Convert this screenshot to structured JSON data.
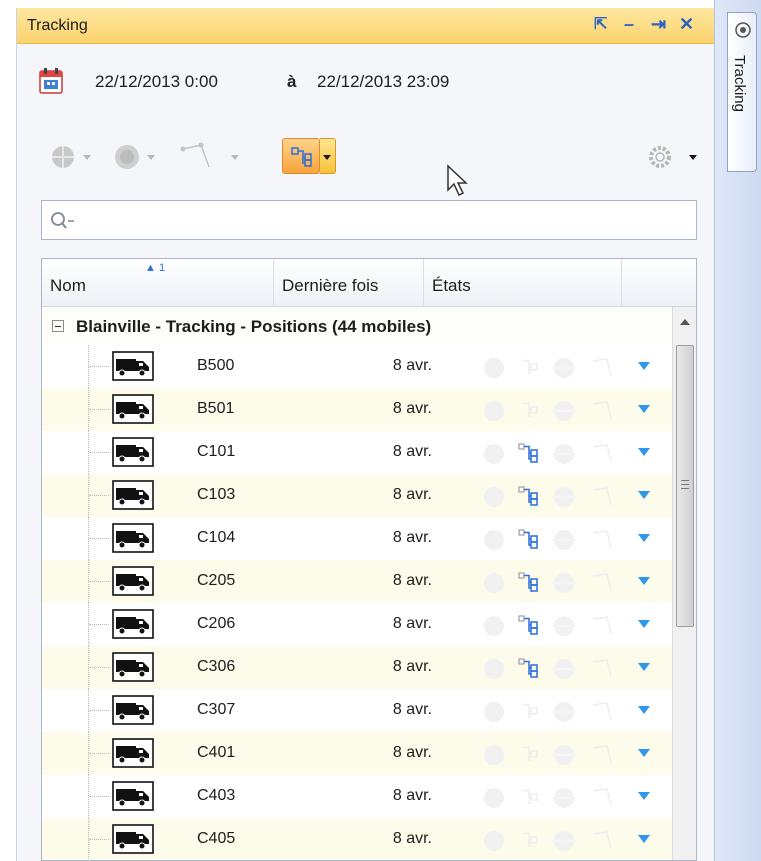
{
  "panel": {
    "title": "Tracking",
    "controls": [
      "⇱",
      "–",
      "⇥",
      "✕"
    ]
  },
  "daterange": {
    "from": "22/12/2013  0:00",
    "separator": "à",
    "to": "22/12/2013  23:09"
  },
  "toolbar": {
    "icons": [
      "map-point-icon",
      "circle-target-icon",
      "route-icon",
      "tree-view-icon",
      "settings-gear-icon"
    ]
  },
  "search": {
    "placeholder": ""
  },
  "grid": {
    "columns": [
      "Nom",
      "Dernière fois",
      "États"
    ],
    "sort_indicator": "1",
    "group_label": "Blainville - Tracking - Positions (44 mobiles)",
    "rows": [
      {
        "name": "B500",
        "date": "8 avr.",
        "tree_state": false
      },
      {
        "name": "B501",
        "date": "8 avr.",
        "tree_state": false
      },
      {
        "name": "C101",
        "date": "8 avr.",
        "tree_state": true
      },
      {
        "name": "C103",
        "date": "8 avr.",
        "tree_state": true
      },
      {
        "name": "C104",
        "date": "8 avr.",
        "tree_state": true
      },
      {
        "name": "C205",
        "date": "8 avr.",
        "tree_state": true
      },
      {
        "name": "C206",
        "date": "8 avr.",
        "tree_state": true
      },
      {
        "name": "C306",
        "date": "8 avr.",
        "tree_state": true
      },
      {
        "name": "C307",
        "date": "8 avr.",
        "tree_state": false
      },
      {
        "name": "C401",
        "date": "8 avr.",
        "tree_state": false
      },
      {
        "name": "C403",
        "date": "8 avr.",
        "tree_state": false
      },
      {
        "name": "C405",
        "date": "8 avr.",
        "tree_state": false
      }
    ]
  },
  "dock": {
    "tab_label": "Tracking"
  },
  "colors": {
    "title_bar": "#fbd26d",
    "row_alt": "#fdfbe9",
    "row_menu_arrow": "#2e97e8",
    "tree_icon": "#2a6fdb"
  }
}
